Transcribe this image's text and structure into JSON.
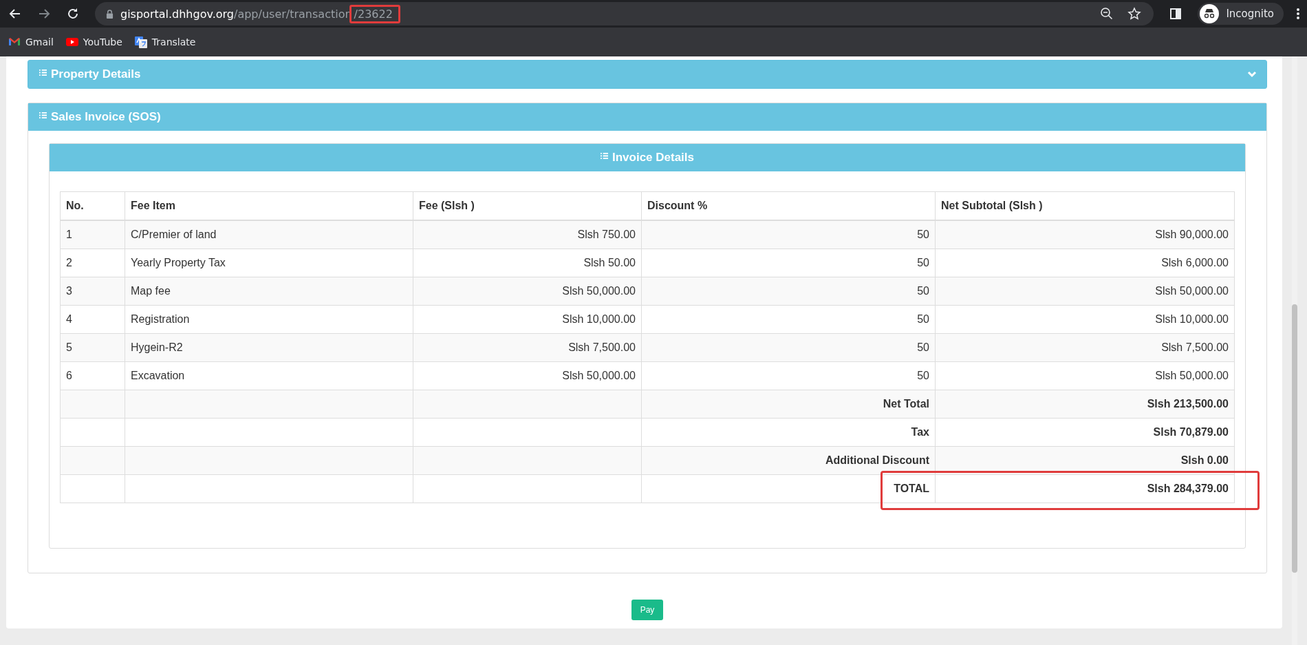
{
  "browser": {
    "url": {
      "host": "gisportal.dhhgov.org",
      "path": "/app/user/transaction",
      "id": "/23622",
      "id_highlighted": true
    },
    "profile": "Incognito",
    "bookmarks": [
      {
        "label": "Gmail",
        "kind": "gmail"
      },
      {
        "label": "YouTube",
        "kind": "youtube"
      },
      {
        "label": "Translate",
        "kind": "translate"
      }
    ]
  },
  "panels": [
    {
      "title": "Property Details",
      "expanded": false
    },
    {
      "title": "Sales Invoice (SOS)",
      "expanded": true
    }
  ],
  "invoice": {
    "title": "Invoice Details",
    "columns": [
      "No.",
      "Fee Item",
      "Fee (Slsh )",
      "Discount %",
      "Net Subtotal (Slsh )"
    ],
    "rows": [
      {
        "no": "1",
        "item": "C/Premier of land",
        "fee": "Slsh 750.00",
        "discount": "50",
        "subtotal": "Slsh 90,000.00"
      },
      {
        "no": "2",
        "item": "Yearly Property Tax",
        "fee": "Slsh 50.00",
        "discount": "50",
        "subtotal": "Slsh 6,000.00"
      },
      {
        "no": "3",
        "item": "Map fee",
        "fee": "Slsh 50,000.00",
        "discount": "50",
        "subtotal": "Slsh 50,000.00"
      },
      {
        "no": "4",
        "item": "Registration",
        "fee": "Slsh 10,000.00",
        "discount": "50",
        "subtotal": "Slsh 10,000.00"
      },
      {
        "no": "5",
        "item": "Hygein-R2",
        "fee": "Slsh 7,500.00",
        "discount": "50",
        "subtotal": "Slsh 7,500.00"
      },
      {
        "no": "6",
        "item": "Excavation",
        "fee": "Slsh 50,000.00",
        "discount": "50",
        "subtotal": "Slsh 50,000.00"
      }
    ],
    "summary": [
      {
        "label": "Net Total",
        "value": "Slsh 213,500.00",
        "highlighted": false
      },
      {
        "label": "Tax",
        "value": "Slsh 70,879.00",
        "highlighted": false
      },
      {
        "label": "Additional Discount",
        "value": "Slsh 0.00",
        "highlighted": false
      },
      {
        "label": "TOTAL",
        "value": "Slsh 284,379.00",
        "highlighted": true
      }
    ]
  },
  "pay_button": "Pay"
}
